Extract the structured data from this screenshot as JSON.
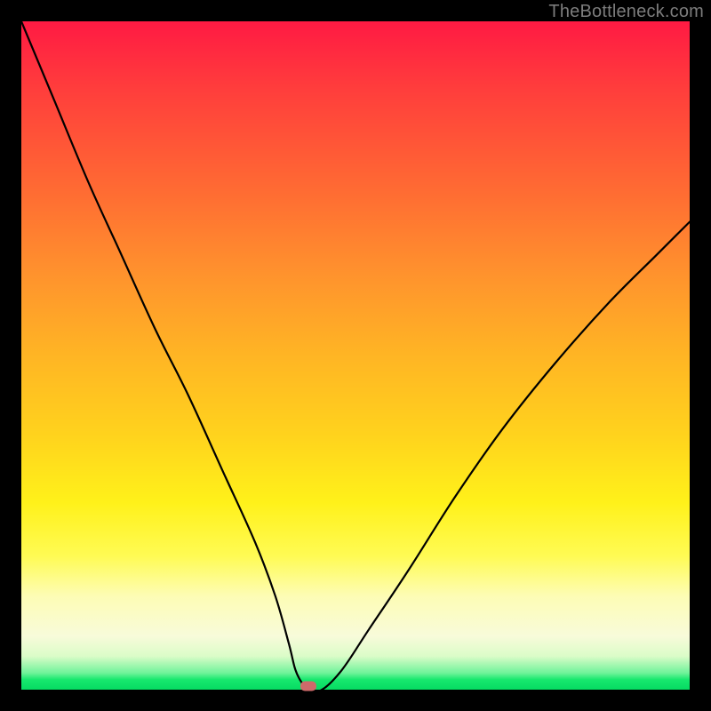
{
  "watermark": "TheBottleneck.com",
  "colors": {
    "frame": "#000000",
    "curve": "#000000",
    "marker": "#cf6a6a",
    "watermark": "#7c7c7c"
  },
  "chart_data": {
    "type": "line",
    "title": "",
    "xlabel": "",
    "ylabel": "",
    "xlim": [
      0,
      100
    ],
    "ylim": [
      0,
      100
    ],
    "grid": false,
    "legend": false,
    "series": [
      {
        "name": "bottleneck-curve",
        "x": [
          0,
          5,
          10,
          15,
          20,
          25,
          30,
          35,
          38,
          40,
          41,
          42,
          43,
          45,
          48,
          52,
          58,
          65,
          72,
          80,
          88,
          95,
          100
        ],
        "values": [
          100,
          88,
          76,
          65,
          54,
          44,
          33,
          22,
          14,
          7,
          3,
          1,
          0,
          0,
          3,
          9,
          18,
          29,
          39,
          49,
          58,
          65,
          70
        ]
      }
    ],
    "marker": {
      "x": 43,
      "y": 0
    },
    "gradient_stops": [
      {
        "pos": 0,
        "color": "#ff1a43"
      },
      {
        "pos": 25,
        "color": "#ff6a33"
      },
      {
        "pos": 50,
        "color": "#ffb524"
      },
      {
        "pos": 72,
        "color": "#fff11a"
      },
      {
        "pos": 92,
        "color": "#f8fbda"
      },
      {
        "pos": 100,
        "color": "#06db62"
      }
    ]
  }
}
